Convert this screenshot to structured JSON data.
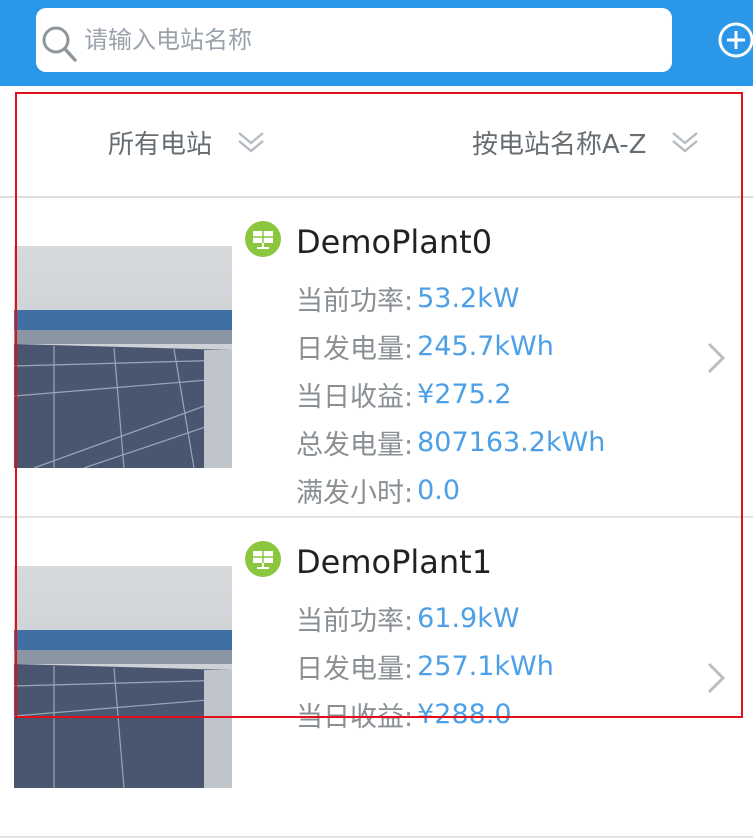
{
  "search": {
    "placeholder": "请输入电站名称",
    "value": ""
  },
  "filters": {
    "station_filter": "所有电站",
    "sort": "按电站名称A-Z"
  },
  "icons": {
    "search": "search-icon",
    "add": "plus-circle-icon",
    "dropdown": "double-chevron-down-icon",
    "plant_type": "solar-panel-icon",
    "row_arrow": "chevron-right-icon"
  },
  "colors": {
    "header": "#2a97e8",
    "value": "#4da0e6",
    "type_badge": "#8cc63f",
    "frame": "#e0101a"
  },
  "plants": [
    {
      "name": "DemoPlant0",
      "stats": [
        {
          "label": "当前功率:",
          "value": "53.2kW"
        },
        {
          "label": "日发电量:",
          "value": "245.7kWh"
        },
        {
          "label": "当日收益:",
          "value": "¥275.2"
        },
        {
          "label": "总发电量:",
          "value": "807163.2kWh"
        },
        {
          "label": "满发小时:",
          "value": "0.0"
        }
      ]
    },
    {
      "name": "DemoPlant1",
      "stats": [
        {
          "label": "当前功率:",
          "value": "61.9kW"
        },
        {
          "label": "日发电量:",
          "value": "257.1kWh"
        },
        {
          "label": "当日收益:",
          "value": "¥288.0"
        }
      ]
    }
  ]
}
